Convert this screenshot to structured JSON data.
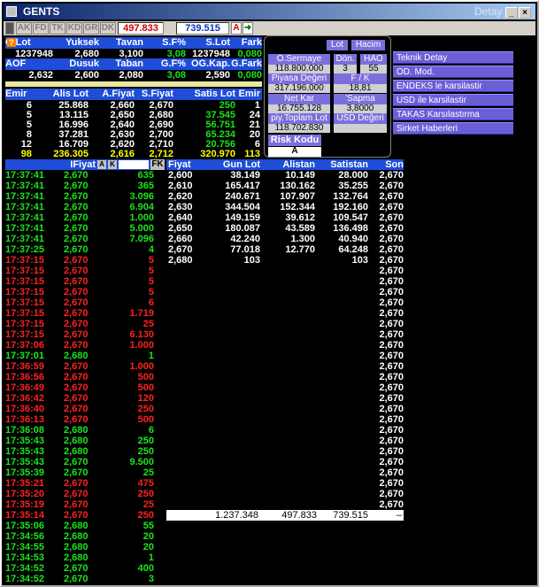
{
  "window": {
    "title": "GENTS",
    "subtitle": "Detay"
  },
  "toolbar": {
    "tabs": [
      "AK",
      "FD",
      "TK",
      "KD",
      "GR",
      "DK"
    ],
    "price_left": "497.833",
    "price_right": "739.515",
    "a_button": "A",
    "arrow": "➜"
  },
  "summary1": {
    "headers": [
      "G.Lot",
      "Yuksek",
      "Tavan",
      "S.F%",
      "S.Lot",
      "Fark"
    ],
    "values": [
      "1237948",
      "2,680",
      "3,100",
      "3,08",
      "1237948",
      "0,080"
    ]
  },
  "summary2": {
    "headers": [
      "AOF",
      "Dusuk",
      "Taban",
      "G.F%",
      "OG.Kap.",
      "G.Fark"
    ],
    "values": [
      "2,632",
      "2,600",
      "2,080",
      "3,08",
      "2,590",
      "0,080"
    ]
  },
  "orderbook": {
    "headers": [
      "Emir",
      "Alis Lot",
      "A.Fiyat",
      "S.Fiyat",
      "Satis Lot",
      "Emir"
    ],
    "rows": [
      [
        "6",
        "25.868",
        "2,660",
        "2,670",
        "250",
        "1"
      ],
      [
        "5",
        "13.115",
        "2,650",
        "2,680",
        "37.545",
        "24"
      ],
      [
        "5",
        "16.996",
        "2,640",
        "2,690",
        "56.751",
        "21"
      ],
      [
        "8",
        "37.281",
        "2,630",
        "2,700",
        "65.234",
        "20"
      ],
      [
        "12",
        "16.709",
        "2,620",
        "2,710",
        "20.756",
        "6"
      ]
    ],
    "total": [
      "98",
      "236.305",
      "2,616",
      "2,712",
      "320.970",
      "113"
    ]
  },
  "panel": {
    "lot": "Lot",
    "hacim": "Hacim",
    "o_sermaye": "O.Sermaye",
    "o_sermaye_val": "118.800.000",
    "don": "Dön.",
    "don_val": "3",
    "hao": "HAO",
    "hao_val": "55",
    "piyasa_degeri": "Piyasa Değeri",
    "piyasa_val": "317.196.000",
    "fk": "F / K",
    "fk_val": "18,81",
    "net_kar": "Net Kar",
    "net_kar_val": "16.755.128",
    "sapma": "'Sapma",
    "sapma_val": "3,8000",
    "piy_toplam_lot": "piy.Toplam Lot",
    "piy_toplam_val": "118.702.830",
    "usd_degeri": "USD Değeri",
    "risk_kodu": "Risk Kodu",
    "risk_val": "A"
  },
  "menu": [
    "Teknik Detay",
    "OD. Mod.",
    "ENDEKS le karsilastir",
    "USD ile karsilastir",
    "TAKAS Karsılastırma",
    "Sirket Haberleri"
  ],
  "trades_header": {
    "fiyat": "IFiyat",
    "a": "A",
    "k": "K",
    "fk": "FK"
  },
  "trades": [
    [
      "17:37:41",
      "2,670",
      "635",
      "g"
    ],
    [
      "17:37:41",
      "2,670",
      "365",
      "g"
    ],
    [
      "17:37:41",
      "2,670",
      "3.096",
      "g"
    ],
    [
      "17:37:41",
      "2,670",
      "6.904",
      "g"
    ],
    [
      "17:37:41",
      "2,670",
      "1.000",
      "g"
    ],
    [
      "17:37:41",
      "2,670",
      "5.000",
      "g"
    ],
    [
      "17:37:41",
      "2,670",
      "7.096",
      "g"
    ],
    [
      "17:37:25",
      "2,670",
      "4",
      "g"
    ],
    [
      "17:37:15",
      "2,670",
      "5",
      "r"
    ],
    [
      "17:37:15",
      "2,670",
      "5",
      "r"
    ],
    [
      "17:37:15",
      "2,670",
      "5",
      "r"
    ],
    [
      "17:37:15",
      "2,670",
      "5",
      "r"
    ],
    [
      "17:37:15",
      "2,670",
      "6",
      "r"
    ],
    [
      "17:37:15",
      "2,670",
      "1.719",
      "r"
    ],
    [
      "17:37:15",
      "2,670",
      "25",
      "r"
    ],
    [
      "17:37:15",
      "2,670",
      "6.130",
      "r"
    ],
    [
      "17:37:06",
      "2,670",
      "1.000",
      "r"
    ],
    [
      "17:37:01",
      "2,680",
      "1",
      "g"
    ],
    [
      "17:36:59",
      "2,670",
      "1.000",
      "r"
    ],
    [
      "17:36:56",
      "2,670",
      "500",
      "r"
    ],
    [
      "17:36:49",
      "2,670",
      "500",
      "r"
    ],
    [
      "17:36:42",
      "2,670",
      "120",
      "r"
    ],
    [
      "17:36:40",
      "2,670",
      "250",
      "r"
    ],
    [
      "17:36:13",
      "2,670",
      "500",
      "r"
    ],
    [
      "17:36:08",
      "2,680",
      "6",
      "g"
    ],
    [
      "17:35:43",
      "2,680",
      "250",
      "g"
    ],
    [
      "17:35:43",
      "2,680",
      "250",
      "g"
    ],
    [
      "17:35:43",
      "2,670",
      "9.500",
      "g"
    ],
    [
      "17:35:39",
      "2,670",
      "25",
      "g"
    ],
    [
      "17:35:21",
      "2,670",
      "475",
      "r"
    ],
    [
      "17:35:20",
      "2,670",
      "250",
      "r"
    ],
    [
      "17:35:19",
      "2,670",
      "25",
      "r"
    ],
    [
      "17:35:14",
      "2,670",
      "250",
      "r"
    ],
    [
      "17:35:06",
      "2,680",
      "55",
      "g"
    ],
    [
      "17:34:56",
      "2,680",
      "20",
      "g"
    ],
    [
      "17:34:55",
      "2,680",
      "20",
      "g"
    ],
    [
      "17:34:53",
      "2,680",
      "1",
      "g"
    ],
    [
      "17:34:52",
      "2,670",
      "400",
      "g"
    ],
    [
      "17:34:52",
      "2,670",
      "3",
      "g"
    ]
  ],
  "depth_header": [
    "Fiyat",
    "Gun Lot",
    "Alistan",
    "Satistan",
    "Son"
  ],
  "depth": [
    [
      "2,600",
      "38.149",
      "10.149",
      "28.000",
      "2,670"
    ],
    [
      "2,610",
      "165.417",
      "130.162",
      "35.255",
      "2,670"
    ],
    [
      "2,620",
      "240.671",
      "107.907",
      "132.764",
      "2,670"
    ],
    [
      "2,630",
      "344.504",
      "152.344",
      "192.160",
      "2,670"
    ],
    [
      "2,640",
      "149.159",
      "39.612",
      "109.547",
      "2,670"
    ],
    [
      "2,650",
      "180.087",
      "43.589",
      "136.498",
      "2,670"
    ],
    [
      "2,660",
      "42.240",
      "1.300",
      "40.940",
      "2,670"
    ],
    [
      "2,670",
      "77.018",
      "12.770",
      "64.248",
      "2,670"
    ],
    [
      "2,680",
      "103",
      "",
      "103",
      "2,670"
    ]
  ],
  "son_extra_count": 28,
  "son_value": "2,670",
  "depth_totals": [
    "1.237.348",
    "497.833",
    "739.515",
    "–"
  ],
  "colors": {
    "green": "#19e619",
    "red": "#ff2020",
    "header": "#1f4dd8",
    "yellow": "#ffff00"
  }
}
